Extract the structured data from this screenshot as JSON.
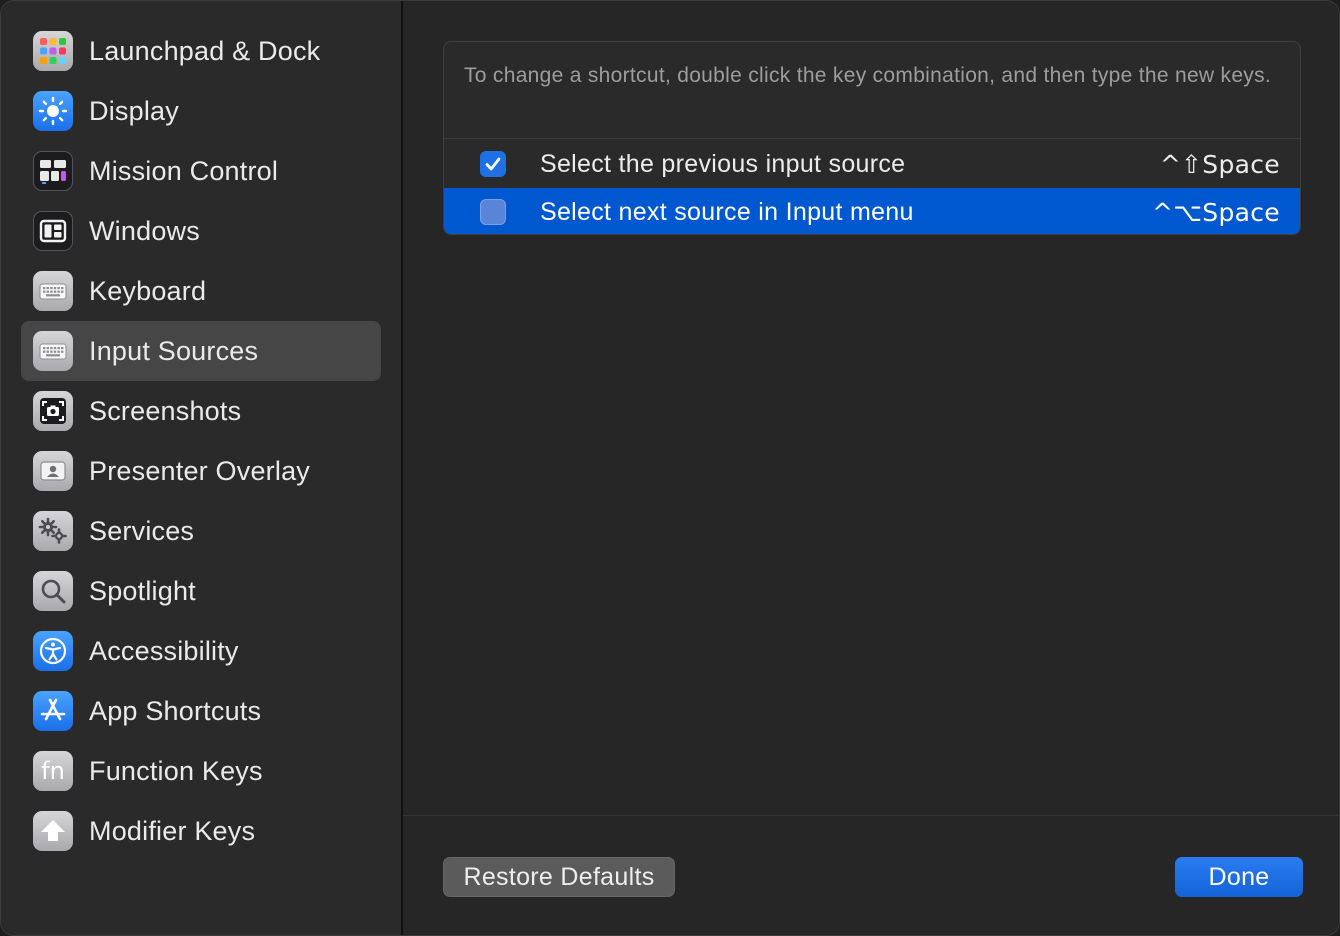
{
  "sidebar": {
    "items": [
      {
        "label": "Launchpad & Dock",
        "icon": "launchpad-icon",
        "selected": false
      },
      {
        "label": "Display",
        "icon": "display-icon",
        "selected": false
      },
      {
        "label": "Mission Control",
        "icon": "mission-control-icon",
        "selected": false
      },
      {
        "label": "Windows",
        "icon": "windows-icon",
        "selected": false
      },
      {
        "label": "Keyboard",
        "icon": "keyboard-icon",
        "selected": false
      },
      {
        "label": "Input Sources",
        "icon": "input-sources-icon",
        "selected": true
      },
      {
        "label": "Screenshots",
        "icon": "screenshots-icon",
        "selected": false
      },
      {
        "label": "Presenter Overlay",
        "icon": "presenter-overlay-icon",
        "selected": false
      },
      {
        "label": "Services",
        "icon": "services-icon",
        "selected": false
      },
      {
        "label": "Spotlight",
        "icon": "spotlight-icon",
        "selected": false
      },
      {
        "label": "Accessibility",
        "icon": "accessibility-icon",
        "selected": false
      },
      {
        "label": "App Shortcuts",
        "icon": "app-shortcuts-icon",
        "selected": false
      },
      {
        "label": "Function Keys",
        "icon": "function-keys-icon",
        "selected": false
      },
      {
        "label": "Modifier Keys",
        "icon": "modifier-keys-icon",
        "selected": false
      }
    ]
  },
  "main": {
    "instructions": "To change a shortcut, double click the key combination, and then type the new keys.",
    "shortcuts": [
      {
        "label": "Select the previous input source",
        "keys": "^⇧Space",
        "enabled": true,
        "selected": false
      },
      {
        "label": "Select next source in Input menu",
        "keys": "^⌥Space",
        "enabled": false,
        "selected": true
      }
    ]
  },
  "footer": {
    "restore_label": "Restore Defaults",
    "done_label": "Done"
  },
  "colors": {
    "accent": "#0058d0",
    "button_blue": "#1f6fe5"
  },
  "icons": {
    "checkmark": "checkmark-icon",
    "fn_text": "fn"
  }
}
